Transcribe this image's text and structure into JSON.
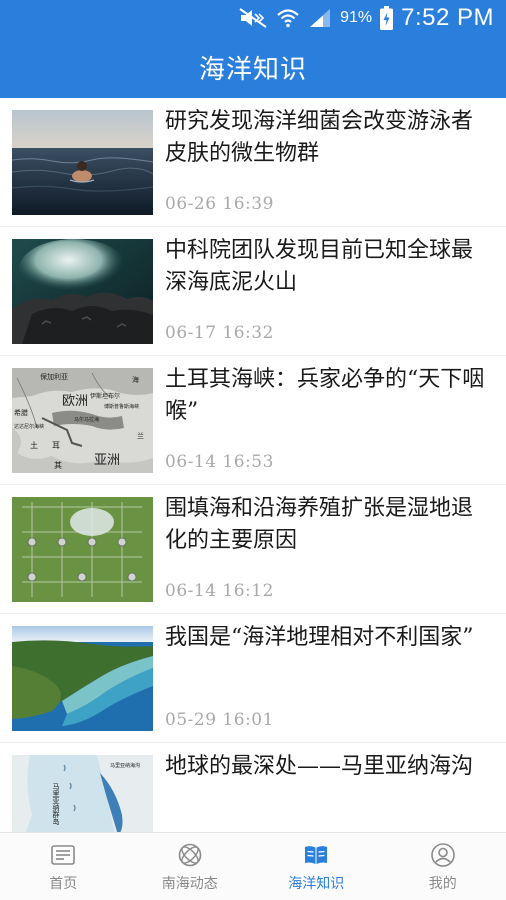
{
  "status_bar": {
    "battery_percent": "91%",
    "time": "7:52 PM"
  },
  "app_bar": {
    "title": "海洋知识"
  },
  "articles": [
    {
      "title": "研究发现海洋细菌会改变游泳者皮肤的微生物群",
      "time": "06-26  16:39",
      "thumb": "swimmer-in-sea"
    },
    {
      "title": "中科院团队发现目前已知全球最深海底泥火山",
      "time": "06-17  16:32",
      "thumb": "seafloor-mud-volcano"
    },
    {
      "title": "土耳其海峡：兵家必争的“天下咽喉”",
      "time": "06-14  16:53",
      "thumb": "strait-map",
      "thumb_labels": {
        "europe": "欧洲",
        "asia": "亚洲",
        "bulgaria": "保加利亚",
        "greece": "希腊",
        "sea_small": "海",
        "istanbul": "伊斯坦布尔",
        "bosporus": "博斯普鲁斯海峡",
        "dardanelles": "达达尼尔海峡",
        "marmara": "马尔马拉海",
        "lan": "兰",
        "er": "耳",
        "qi": "其",
        "fu": "土"
      }
    },
    {
      "title": "围填海和沿海养殖扩张是湿地退化的主要原因",
      "time": "06-14  16:12",
      "thumb": "aquaculture-ponds"
    },
    {
      "title": "我国是“海洋地理相对不利国家”",
      "time": "05-29  16:01",
      "thumb": "coastline-aerial"
    },
    {
      "title": "地球的最深处——马里亚纳海沟",
      "time": "",
      "thumb": "mariana-map",
      "thumb_labels": {
        "trench": "马里亚纳海沟",
        "islands": "马里亚纳群岛"
      }
    }
  ],
  "bottom_nav": [
    {
      "label": "首页",
      "icon": "news-icon",
      "active": false
    },
    {
      "label": "南海动态",
      "icon": "orbit-icon",
      "active": false
    },
    {
      "label": "海洋知识",
      "icon": "open-book-icon",
      "active": true
    },
    {
      "label": "我的",
      "icon": "user-circle-icon",
      "active": false
    }
  ],
  "colors": {
    "primary": "#2a7fdc",
    "nav_inactive": "#8a8a8a",
    "time_text": "#a9a9a9"
  }
}
